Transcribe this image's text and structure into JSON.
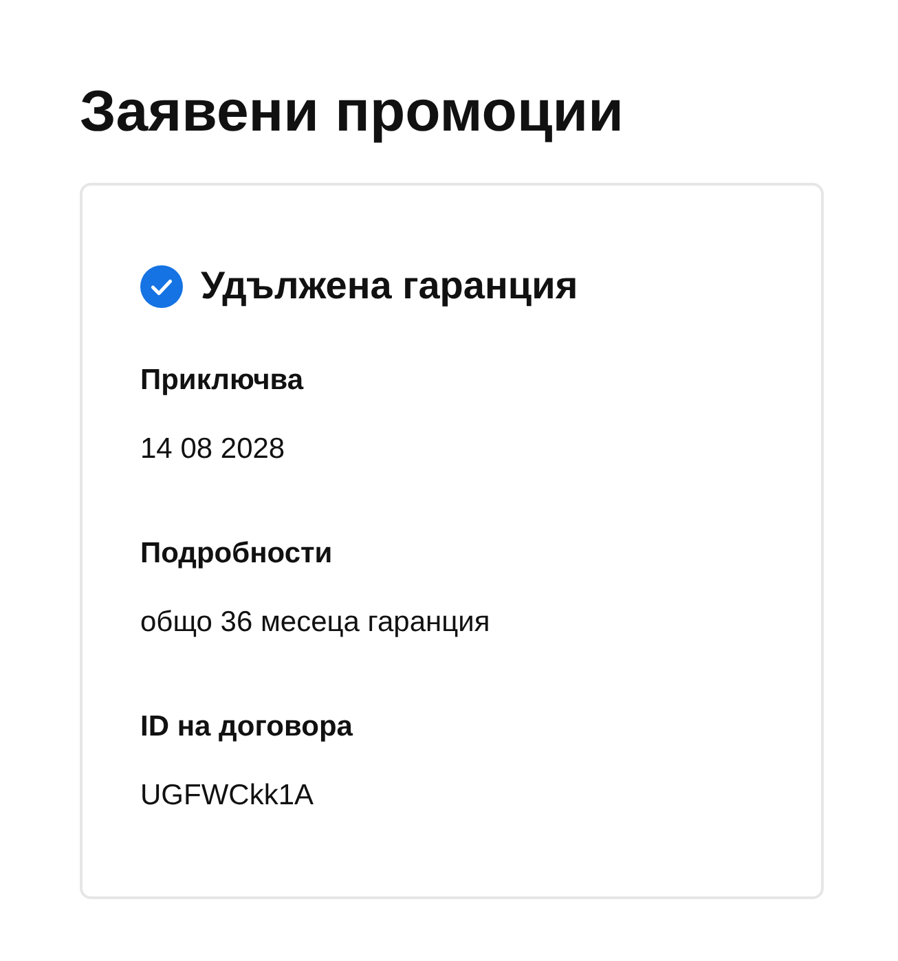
{
  "page": {
    "title": "Заявени промоции"
  },
  "promotion": {
    "title": "Удължена гаранция",
    "verified": true,
    "fields": [
      {
        "label": "Приключва",
        "value": "14 08 2028"
      },
      {
        "label": "Подробности",
        "value": "общо 36 месеца гаранция"
      },
      {
        "label": "ID на договора",
        "value": "UGFWCkk1A"
      }
    ]
  }
}
